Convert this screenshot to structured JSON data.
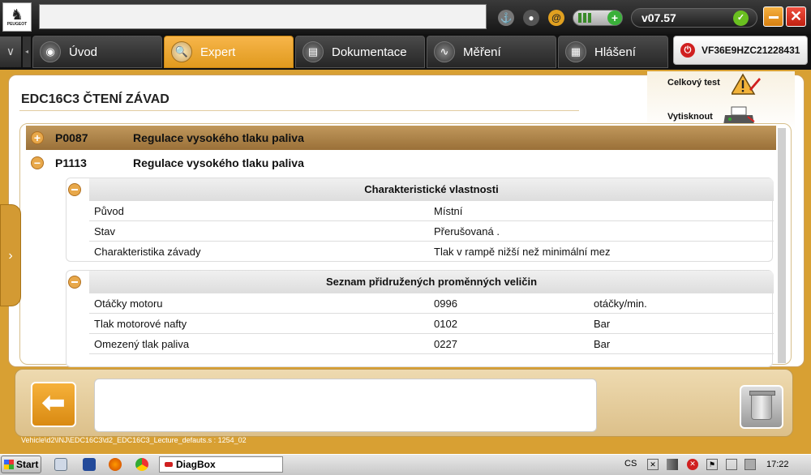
{
  "topbar": {
    "version": "v07.57",
    "logo_text": "PEUGEOT"
  },
  "tabs": [
    {
      "label": "Úvod",
      "active": false
    },
    {
      "label": "Expert",
      "active": true
    },
    {
      "label": "Dokumentace",
      "active": false
    },
    {
      "label": "Měření",
      "active": false
    },
    {
      "label": "Hlášení",
      "active": false
    }
  ],
  "vin": "VF36E9HZC21228431",
  "page": {
    "title": "EDC16C3  ČTENÍ ZÁVAD",
    "actions": {
      "test": "Celkový test",
      "print": "Vytisknout"
    }
  },
  "faults": [
    {
      "code": "P0087",
      "description": "Regulace vysokého tlaku paliva",
      "expanded": false
    },
    {
      "code": "P1113",
      "description": "Regulace vysokého tlaku paliva",
      "expanded": true
    }
  ],
  "characteristics": {
    "header": "Charakteristické vlastnosti",
    "rows": [
      {
        "name": "Původ",
        "value": "Místní"
      },
      {
        "name": "Stav",
        "value": "Přerušovaná ."
      },
      {
        "name": "Charakteristika závady",
        "value": "Tlak v rampě nižší než minimální mez"
      }
    ]
  },
  "variables": {
    "header": "Seznam přidružených proměnných veličin",
    "rows": [
      {
        "name": "Otáčky motoru",
        "value": "0996",
        "unit": "otáčky/min."
      },
      {
        "name": "Tlak motorové nafty",
        "value": "0102",
        "unit": "Bar"
      },
      {
        "name": "Omezený tlak paliva",
        "value": "0227",
        "unit": "Bar"
      }
    ]
  },
  "footer": {
    "path": "Vehicle\\d2\\INJ\\EDC16C3\\d2_EDC16C3_Lecture_defauts.s : 1254_02"
  },
  "taskbar": {
    "start": "Start",
    "app": "DiagBox",
    "lang": "CS",
    "time": "17:22"
  },
  "colors": {
    "accent": "#e8a530",
    "fault_selected": "#a87a40"
  }
}
